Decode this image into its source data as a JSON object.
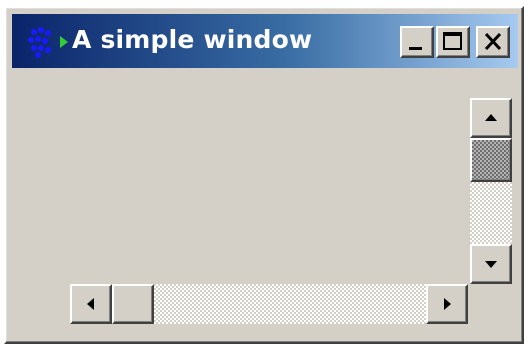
{
  "window": {
    "title": "A simple window",
    "icon": "java-duke-arrow-icon"
  },
  "title_buttons": {
    "minimize_icon": "minimize-icon",
    "maximize_icon": "maximize-icon",
    "close_icon": "close-icon"
  },
  "vertical_scrollbar": {
    "up_icon": "arrow-up-icon",
    "down_icon": "arrow-down-icon",
    "position": 0.0
  },
  "horizontal_scrollbar": {
    "left_icon": "arrow-left-icon",
    "right_icon": "arrow-right-icon",
    "position": 0.0
  },
  "colors": {
    "title_start": "#0a246a",
    "title_end": "#a6caf0",
    "face": "#d4d0c8"
  }
}
